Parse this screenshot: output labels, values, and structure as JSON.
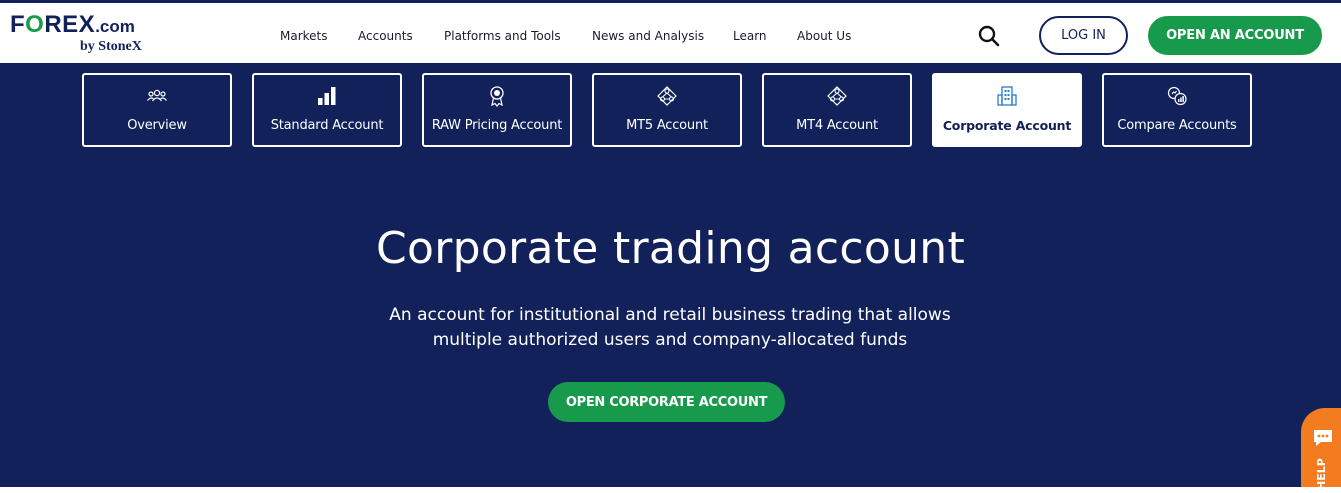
{
  "brand": {
    "logo_main_pre": "F",
    "logo_main_accent": "O",
    "logo_main_post": "REX",
    "logo_dotcom": ".com",
    "logo_sub": "by StoneX",
    "accent_color": "#189a4d",
    "primary_color": "#13215a"
  },
  "nav": {
    "items": [
      {
        "label": "Markets"
      },
      {
        "label": "Accounts"
      },
      {
        "label": "Platforms and Tools"
      },
      {
        "label": "News and Analysis"
      },
      {
        "label": "Learn"
      },
      {
        "label": "About Us"
      }
    ],
    "search_icon": "search-icon",
    "login_label": "LOG IN",
    "open_account_label": "OPEN AN ACCOUNT"
  },
  "tabs": [
    {
      "label": "Overview",
      "icon": "users-icon",
      "active": false
    },
    {
      "label": "Standard Account",
      "icon": "bar-chart-icon",
      "active": false
    },
    {
      "label": "RAW Pricing Account",
      "icon": "award-icon",
      "active": false
    },
    {
      "label": "MT5 Account",
      "icon": "network-icon",
      "active": false
    },
    {
      "label": "MT4 Account",
      "icon": "network-icon",
      "active": false
    },
    {
      "label": "Corporate Account",
      "icon": "building-icon",
      "active": true
    },
    {
      "label": "Compare Accounts",
      "icon": "compare-icon",
      "active": false
    }
  ],
  "hero": {
    "title": "Corporate trading account",
    "description_line1": "An account for institutional and retail business trading that allows",
    "description_line2": "multiple authorized users and company-allocated funds",
    "cta_label": "OPEN CORPORATE ACCOUNT"
  },
  "help": {
    "label": "HELP",
    "icon": "chat-icon",
    "color": "#f47c20"
  }
}
